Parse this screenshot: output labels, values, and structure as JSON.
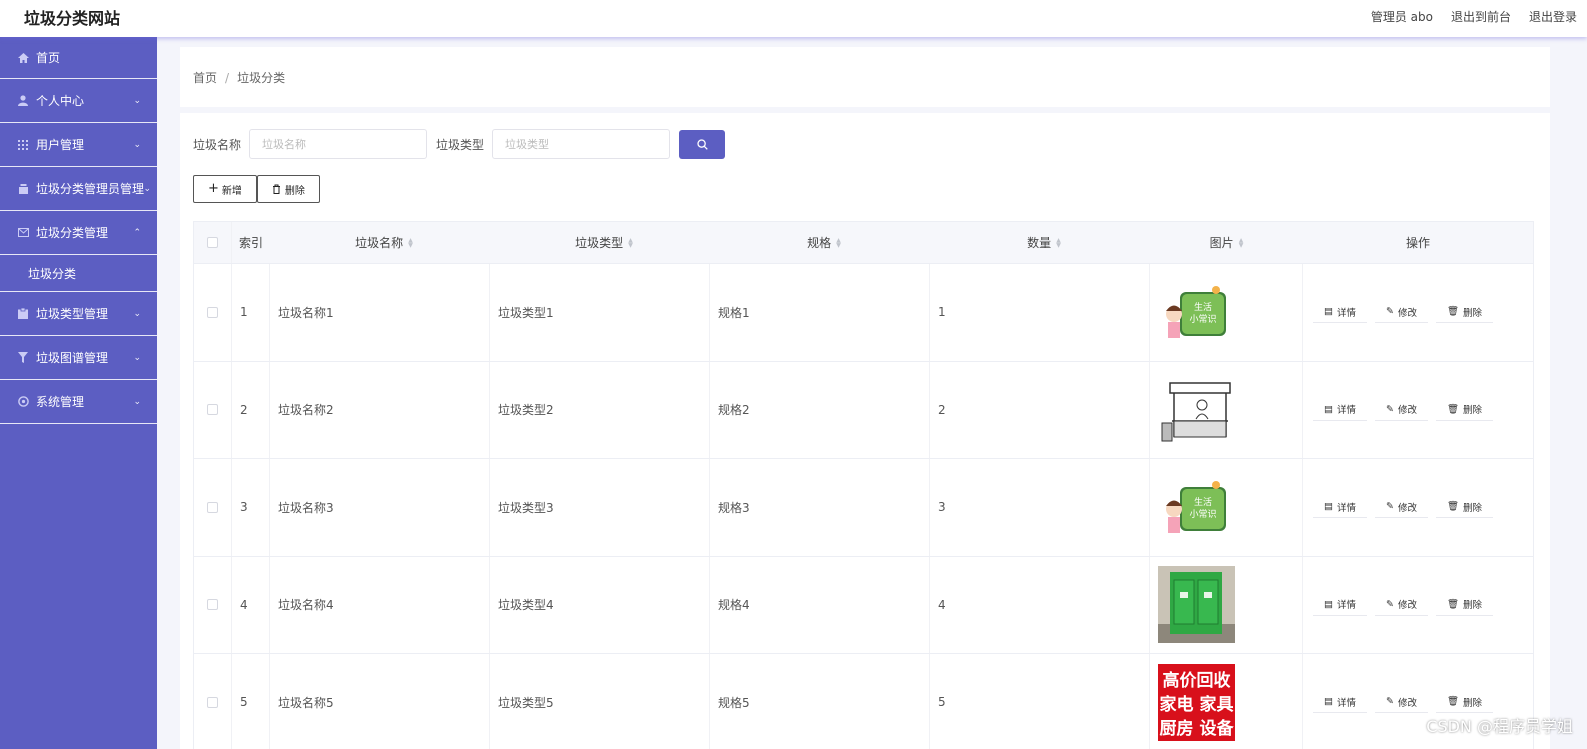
{
  "header": {
    "site_title": "垃圾分类网站",
    "admin_label": "管理员 abo",
    "back_label": "退出到前台",
    "logout_label": "退出登录"
  },
  "sidebar": {
    "items": [
      {
        "label": "首页",
        "icon": "home-icon"
      },
      {
        "label": "个人中心",
        "icon": "user-icon"
      },
      {
        "label": "用户管理",
        "icon": "grid-icon"
      },
      {
        "label": "垃圾分类管理员管理",
        "icon": "tray-icon"
      },
      {
        "label": "垃圾分类管理",
        "icon": "mail-icon",
        "expanded": true,
        "children": [
          {
            "label": "垃圾分类"
          }
        ]
      },
      {
        "label": "垃圾类型管理",
        "icon": "clipboard-icon"
      },
      {
        "label": "垃圾图谱管理",
        "icon": "funnel-icon"
      },
      {
        "label": "系统管理",
        "icon": "settings-icon"
      }
    ]
  },
  "breadcrumb": {
    "home": "首页",
    "sep": "/",
    "current": "垃圾分类"
  },
  "search": {
    "name_label": "垃圾名称",
    "name_placeholder": "垃圾名称",
    "type_label": "垃圾类型",
    "type_placeholder": "垃圾类型"
  },
  "actions": {
    "add_label": "新增",
    "delete_label": "删除"
  },
  "table": {
    "headers": [
      "索引",
      "垃圾名称",
      "垃圾类型",
      "规格",
      "数量",
      "图片",
      "操作"
    ],
    "rows": [
      {
        "index": "1",
        "name": "垃圾名称1",
        "type": "垃圾类型1",
        "spec": "规格1",
        "qty": "1",
        "image": "image-life-tips"
      },
      {
        "index": "2",
        "name": "垃圾名称2",
        "type": "垃圾类型2",
        "spec": "规格2",
        "qty": "2",
        "image": "image-stall-sketch"
      },
      {
        "index": "3",
        "name": "垃圾名称3",
        "type": "垃圾类型3",
        "spec": "规格3",
        "qty": "3",
        "image": "image-life-tips"
      },
      {
        "index": "4",
        "name": "垃圾名称4",
        "type": "垃圾类型4",
        "spec": "规格4",
        "qty": "4",
        "image": "image-green-bin"
      },
      {
        "index": "5",
        "name": "垃圾名称5",
        "type": "垃圾类型5",
        "spec": "规格5",
        "qty": "5",
        "image": "image-recycle-sign"
      }
    ],
    "op_labels": {
      "detail": "详情",
      "edit": "修改",
      "delete": "删除"
    }
  },
  "images": {
    "life_tips_text": [
      "生活",
      "小常识"
    ],
    "recycle_text": [
      "高价回收",
      "家电 家具",
      "厨房 设备"
    ]
  },
  "watermark": "CSDN @程序员学姐",
  "colors": {
    "sidebar": "#5c5ec2",
    "accent": "#5c5ec2",
    "recycle_red": "#d8101b",
    "bin_green": "#2fa844"
  }
}
